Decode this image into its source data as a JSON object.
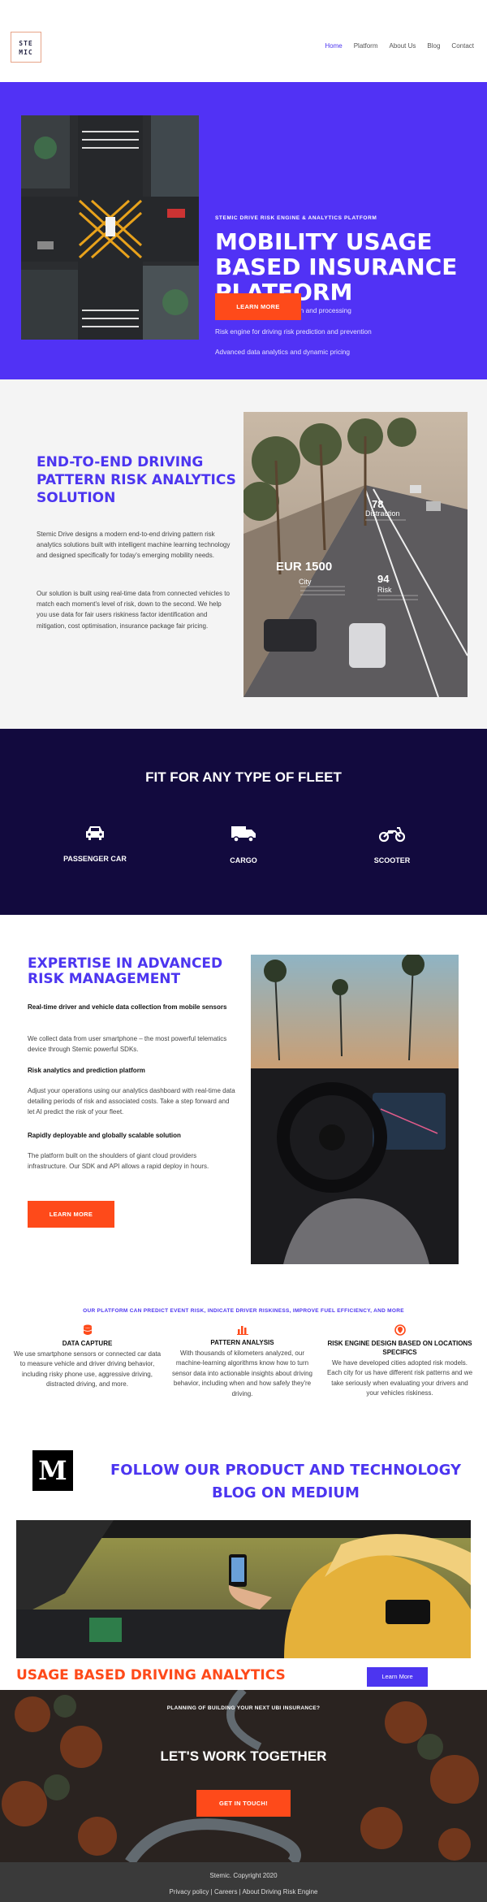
{
  "header": {
    "logo_text": "STE MIC",
    "nav": [
      "Home",
      "Platform",
      "About Us",
      "Blog",
      "Contact"
    ]
  },
  "hero": {
    "kicker": "STEMIC DRIVE RISK ENGINE & ANALYTICS PLATFORM",
    "title": "MOBILITY USAGE BASED INSURANCE PLATFORM",
    "bullets": [
      "Driving pattern data collection and processing",
      "Risk engine for driving risk prediction and prevention",
      "Advanced data analytics and dynamic pricing"
    ],
    "button": "LEARN MORE"
  },
  "solution": {
    "title": "END-TO-END DRIVING PATTERN RISK ANALYTICS SOLUTION",
    "p1": "Stemic Drive designs a modern end-to-end driving pattern risk analytics solutions built with intelligent machine learning technology and designed specifically for today's emerging mobility needs.",
    "p2": "Our solution is built using real-time data from connected vehicles to match each moment's level of risk, down to the second. We help you use data for fair users riskiness factor identification and mitigation, cost optimisation, insurance package fair pricing.",
    "overlay": {
      "price": "EUR 1500",
      "city": "City",
      "risk_num": "94",
      "risk": "Risk",
      "distraction_num": "78",
      "distraction": "Distraction"
    }
  },
  "fleet": {
    "title": "FIT FOR ANY TYPE OF FLEET",
    "items": [
      "PASSENGER CAR",
      "CARGO",
      "SCOOTER"
    ]
  },
  "expertise": {
    "title": "EXPERTISE IN ADVANCED RISK MANAGEMENT",
    "h1": "Real-time driver and vehicle data collection from mobile sensors",
    "p1": "We collect data from user smartphone – the most powerful telematics device through Stemic powerful SDKs.",
    "h2": "Risk analytics and prediction platform",
    "p2": "Adjust your operations using our analytics dashboard with real-time data detailing periods of risk and associated costs. Take a step forward and let AI predict the risk of your fleet.",
    "h3": "Rapidly deployable and globally scalable solution",
    "p3": "The platform built on the shoulders of giant cloud providers infrastructure. Our SDK and API allows a rapid deploy in hours.",
    "button": "LEARN MORE"
  },
  "features": {
    "kicker": "OUR PLATFORM CAN PREDICT EVENT RISK, INDICATE DRIVER RISKINESS, IMPROVE FUEL EFFICIENCY, AND MORE",
    "items": [
      {
        "title": "DATA CAPTURE",
        "desc": "We use smartphone sensors or connected car data to measure vehicle and driver driving behavior, including risky phone use, aggressive driving, distracted driving, and more."
      },
      {
        "title": "PATTERN ANALYSIS",
        "desc": "With thousands of kilometers analyzed, our machine-learning algorithms know how to turn sensor data into actionable insights about driving behavior, including when and how safely they're driving."
      },
      {
        "title": "RISK ENGINE DESIGN BASED ON LOCATIONS SPECIFICS",
        "desc": "We have developed cities adopted risk models. Each city for us have different risk patterns and we take seriously when evaluating your drivers and your vehicles riskiness."
      }
    ]
  },
  "medium": {
    "logo": "M",
    "text": "FOLLOW OUR PRODUCT AND TECHNOLOGY BLOG ON MEDIUM"
  },
  "analytics": {
    "title": "USAGE BASED DRIVING ANALYTICS",
    "button": "Learn More"
  },
  "cta": {
    "kicker": "PLANNING OF BUILDING YOUR NEXT UBI INSURANCE?",
    "title": "LET'S WORK TOGETHER",
    "button": "GET IN TOUCH!"
  },
  "footer": {
    "copyright": "Stemic. Copyright 2020",
    "links": [
      "Privacy policy",
      "Careers",
      "About Driving Risk Engine"
    ]
  }
}
